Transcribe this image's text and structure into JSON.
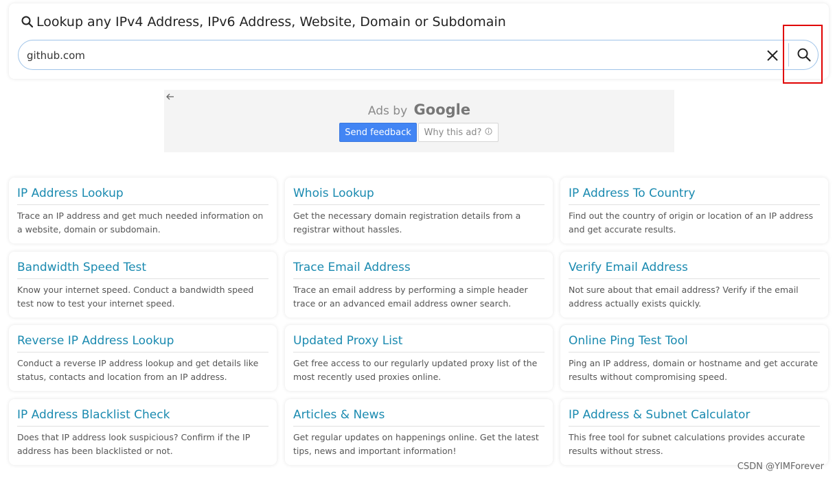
{
  "search": {
    "heading": "Lookup any IPv4 Address, IPv6 Address, Website, Domain or Subdomain",
    "value": "github.com",
    "placeholder": ""
  },
  "ad": {
    "ads_by": "Ads by",
    "brand": "Google",
    "send_feedback": "Send feedback",
    "why_this_ad": "Why this ad?"
  },
  "tools": [
    {
      "title": "IP Address Lookup",
      "description": "Trace an IP address and get much needed information on a website, domain or subdomain."
    },
    {
      "title": "Whois Lookup",
      "description": "Get the necessary domain registration details from a registrar without hassles."
    },
    {
      "title": "IP Address To Country",
      "description": "Find out the country of origin or location of an IP address and get accurate results."
    },
    {
      "title": "Bandwidth Speed Test",
      "description": "Know your internet speed. Conduct a bandwidth speed test now to test your internet speed."
    },
    {
      "title": "Trace Email Address",
      "description": "Trace an email address by performing a simple header trace or an advanced email address owner search."
    },
    {
      "title": "Verify Email Address",
      "description": "Not sure about that email address? Verify if the email address actually exists quickly."
    },
    {
      "title": "Reverse IP Address Lookup",
      "description": "Conduct a reverse IP address lookup and get details like status, contacts and location from an IP address."
    },
    {
      "title": "Updated Proxy List",
      "description": "Get free access to our regularly updated proxy list of the most recently used proxies online."
    },
    {
      "title": "Online Ping Test Tool",
      "description": "Ping an IP address, domain or hostname and get accurate results without compromising speed."
    },
    {
      "title": "IP Address Blacklist Check",
      "description": "Does that IP address look suspicious? Confirm if the IP address has been blacklisted or not."
    },
    {
      "title": "Articles & News",
      "description": "Get regular updates on happenings online. Get the latest tips, news and important information!"
    },
    {
      "title": "IP Address & Subnet Calculator",
      "description": "This free tool for subnet calculations provides accurate results without stress."
    }
  ],
  "watermark": "CSDN @YIMForever",
  "colors": {
    "link": "#1a8ab0",
    "highlight": "#e00000",
    "feedback_button": "#4285f4"
  }
}
